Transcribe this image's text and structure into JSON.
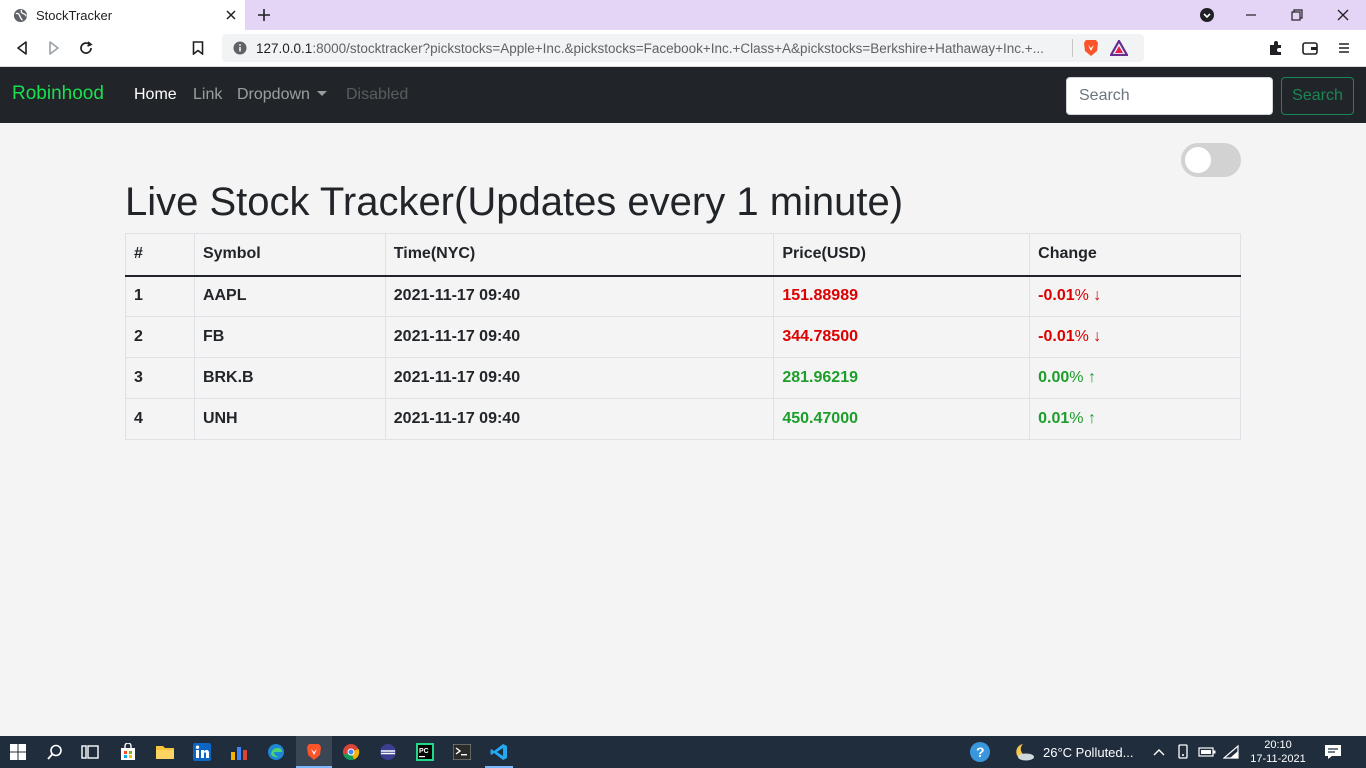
{
  "browser": {
    "tab_title": "StockTracker",
    "url_host": "127.0.0.1",
    "url_rest": ":8000/stocktracker?pickstocks=Apple+Inc.&pickstocks=Facebook+Inc.+Class+A&pickstocks=Berkshire+Hathaway+Inc.+..."
  },
  "navbar": {
    "brand": "Robinhood",
    "links": [
      "Home",
      "Link",
      "Dropdown",
      "Disabled"
    ],
    "search_placeholder": "Search",
    "search_button": "Search"
  },
  "main": {
    "title": "Live Stock Tracker(Updates every 1 minute)",
    "table": {
      "headers": [
        "#",
        "Symbol",
        "Time(NYC)",
        "Price(USD)",
        "Change"
      ],
      "rows": [
        {
          "num": "1",
          "symbol": "AAPL",
          "time": "2021-11-17 09:40",
          "price": "151.88989",
          "change": "-0.01",
          "pct": "%",
          "arrow": "↓",
          "direction": "down"
        },
        {
          "num": "2",
          "symbol": "FB",
          "time": "2021-11-17 09:40",
          "price": "344.78500",
          "change": "-0.01",
          "pct": "%",
          "arrow": "↓",
          "direction": "down"
        },
        {
          "num": "3",
          "symbol": "BRK.B",
          "time": "2021-11-17 09:40",
          "price": "281.96219",
          "change": "0.00",
          "pct": "%",
          "arrow": "↑",
          "direction": "up"
        },
        {
          "num": "4",
          "symbol": "UNH",
          "time": "2021-11-17 09:40",
          "price": "450.47000",
          "change": "0.01",
          "pct": "%",
          "arrow": "↑",
          "direction": "up"
        }
      ]
    }
  },
  "taskbar": {
    "weather": "26°C  Polluted...",
    "time": "20:10",
    "date": "17-11-2021"
  },
  "colors": {
    "brand": "#19e04f",
    "down": "#dc0000",
    "up": "#1d9e2a",
    "navbar_bg": "#212529"
  }
}
